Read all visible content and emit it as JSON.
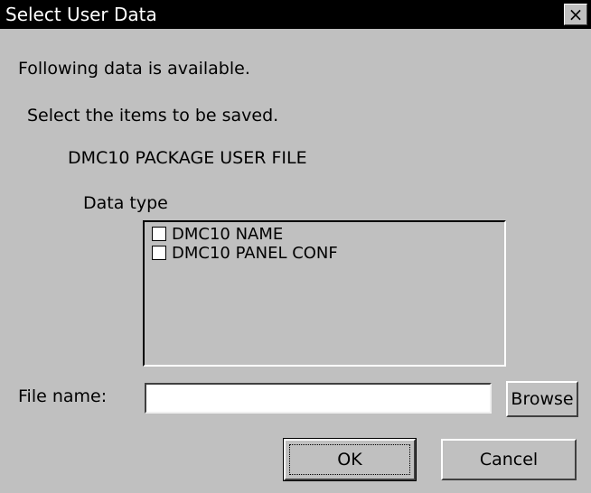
{
  "window": {
    "title": "Select User Data",
    "close_glyph": "×"
  },
  "content": {
    "line1": "Following data is available.",
    "line2": "Select the items to be saved.",
    "line3": "DMC10 PACKAGE USER FILE",
    "data_type_label": "Data type"
  },
  "list": {
    "items": [
      {
        "label": "DMC10 NAME",
        "checked": false
      },
      {
        "label": "DMC10 PANEL CONF",
        "checked": false
      }
    ]
  },
  "file": {
    "label": "File name:",
    "value": "",
    "browse_label": "Browse"
  },
  "buttons": {
    "ok_label": "OK",
    "cancel_label": "Cancel"
  }
}
